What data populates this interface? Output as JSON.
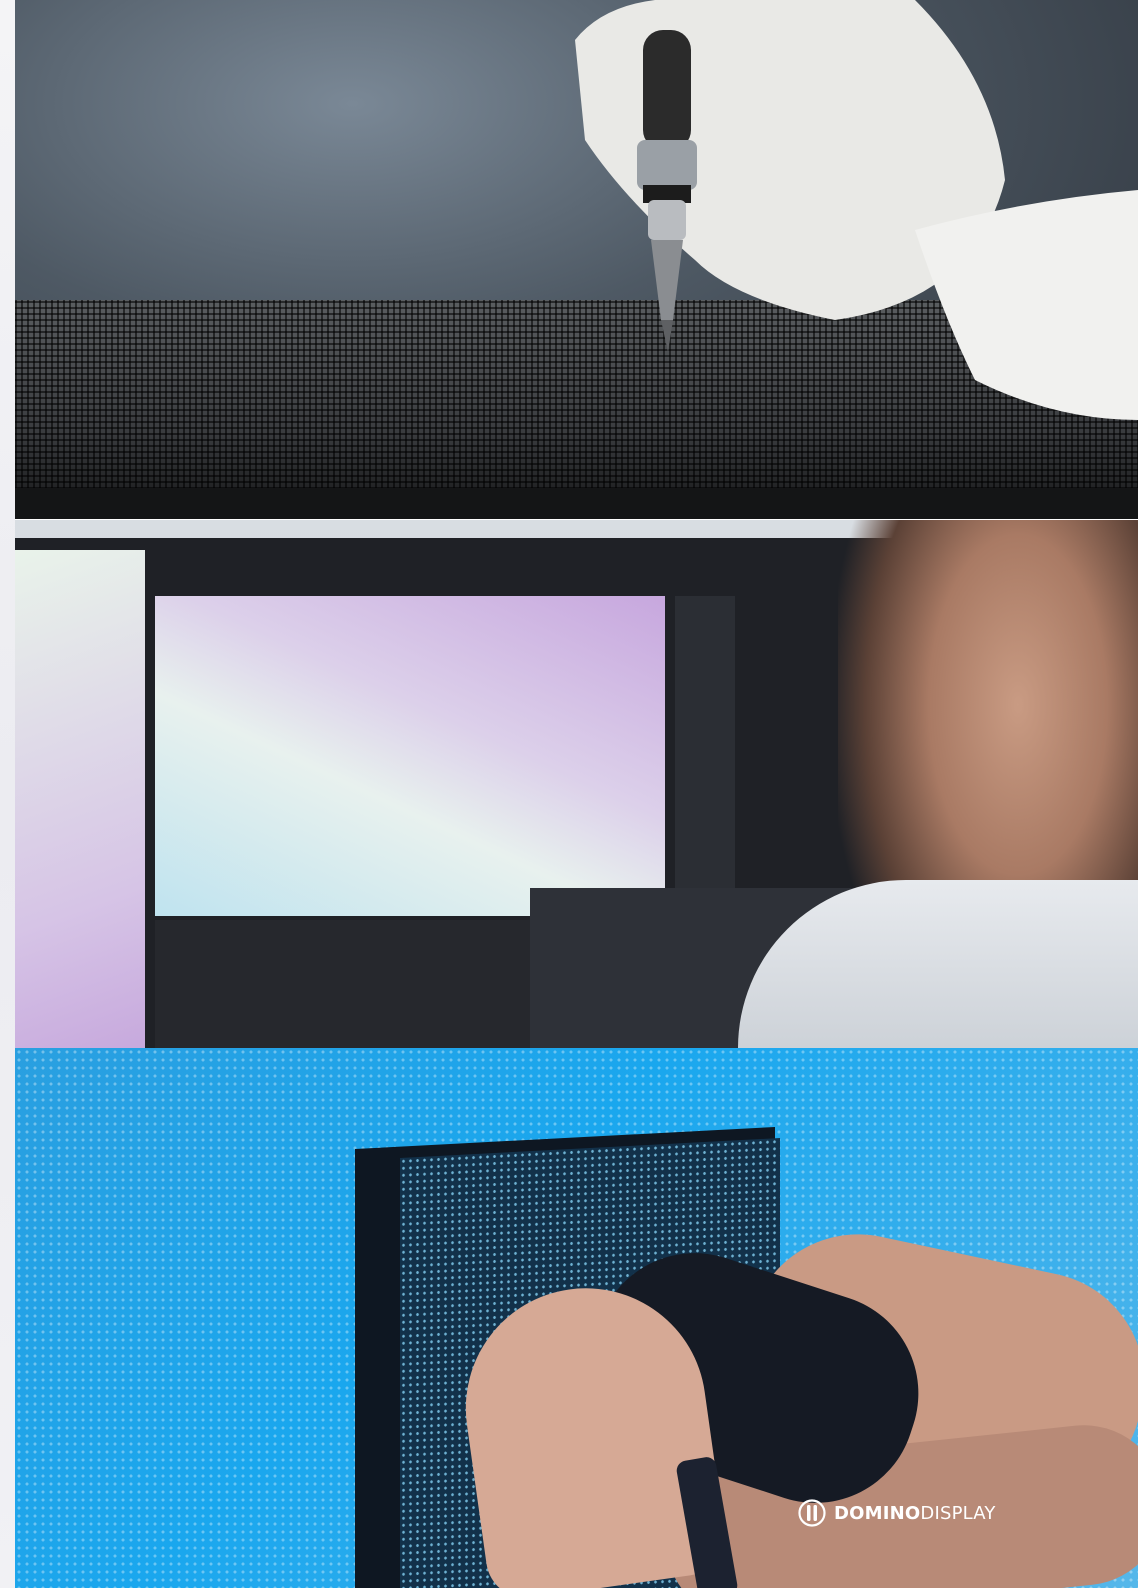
{
  "brand": {
    "name_bold": "DOMINO",
    "name_light": "DISPLAY"
  },
  "photos": [
    {
      "subject": "soldering-iron-on-led-panel"
    },
    {
      "subject": "man-editing-video-on-monitor"
    },
    {
      "subject": "hand-installing-led-module"
    }
  ],
  "colors": {
    "led_blue": "#1aa7ee",
    "logo_white": "#ffffff"
  }
}
